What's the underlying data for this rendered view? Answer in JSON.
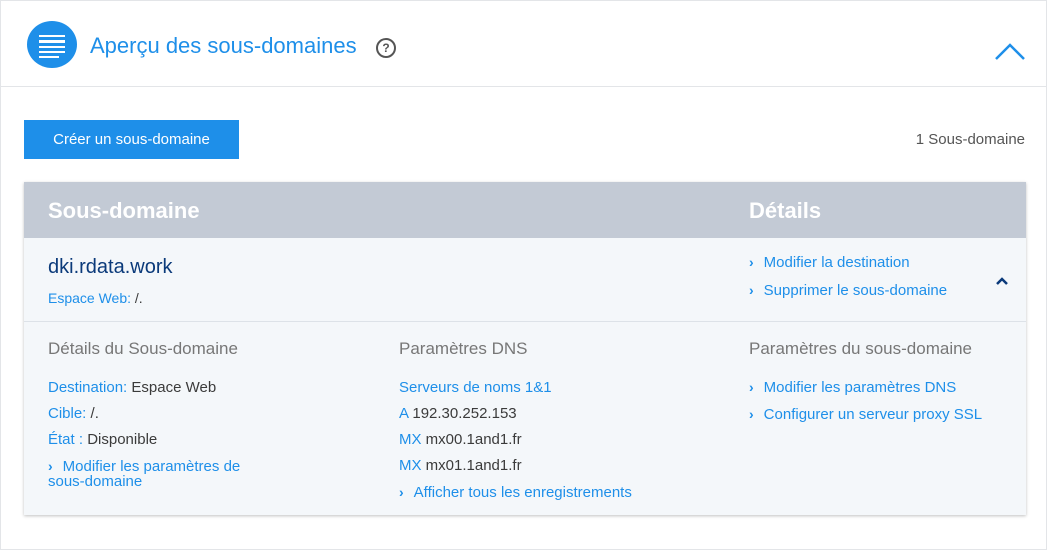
{
  "panel": {
    "title": "Aperçu des sous-domaines",
    "help_glyph": "?",
    "icon": "list-icon",
    "collapse_icon": "chevron-up-icon"
  },
  "toolbar": {
    "create_label": "Créer un sous-domaine",
    "count_label": "1 Sous-domaine"
  },
  "table": {
    "headers": {
      "subdomain": "Sous-domaine",
      "details": "Détails"
    },
    "row": {
      "domain": "dki.rdata.work",
      "space_label": "Espace Web:",
      "space_value": "/.",
      "actions": [
        {
          "label": "Modifier la destination"
        },
        {
          "label": "Supprimer le sous-domaine"
        }
      ],
      "chevron": ">"
    },
    "details": {
      "subdomain_details": {
        "title": "Détails du Sous-domaine",
        "destination_label": "Destination:",
        "destination_value": "Espace Web",
        "target_label": "Cible:",
        "target_value": "/.",
        "status_label": "État :",
        "status_value": "Disponible",
        "edit_link": "Modifier les paramètres de sous-domaine"
      },
      "dns": {
        "title": "Paramètres DNS",
        "nameservers": "Serveurs de noms 1&1",
        "records": [
          {
            "type": "A",
            "value": "192.30.252.153"
          },
          {
            "type": "MX",
            "value": "mx00.1and1.fr"
          },
          {
            "type": "MX",
            "value": "mx01.1and1.fr"
          }
        ],
        "show_all": "Afficher tous les enregistrements"
      },
      "settings": {
        "title": "Paramètres du sous-domaine",
        "links": [
          {
            "label": "Modifier les paramètres DNS"
          },
          {
            "label": "Configurer un serveur proxy SSL"
          }
        ]
      }
    }
  },
  "colors": {
    "accent": "#1e8fe9",
    "header_bg": "#c3cad5",
    "domain": "#0b3a7a"
  }
}
